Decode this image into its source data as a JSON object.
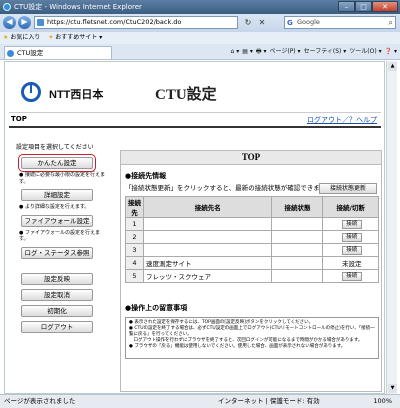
{
  "window": {
    "title": "CTU設定 - Windows Internet Explorer",
    "min": "–",
    "max": "□",
    "close": "✕"
  },
  "address": {
    "url": "https://ctu.fletsnet.com/CtuC202/back.do",
    "search_text": "Google",
    "back": "◀",
    "forward": "▶",
    "refresh": "↻",
    "stop": "✕"
  },
  "favorites": {
    "fav_label": "お気に入り",
    "suggest_label": "おすすめサイト ▾"
  },
  "tab": {
    "label": "CTU設定"
  },
  "commands": [
    "⌂ ▾",
    "▤ ▾",
    "🖶 ▾",
    "ページ(P) ▾",
    "セーフティ(S) ▾",
    "ツール(O) ▾",
    "❓ ▾"
  ],
  "header": {
    "brand": "NTT西日本",
    "title": "CTU設定"
  },
  "crumb": {
    "page": "TOP",
    "links": "ログアウト／？ヘルプ"
  },
  "side": {
    "hint": "設定項目を選択してください",
    "easy": "かんたん設定",
    "easy_note": "● 接続に必要な最小限の設定を行えます。",
    "detail": "詳細設定",
    "detail_note": "● より詳細な設定を行えます。",
    "firewall": "ファイアウォール設定",
    "firewall_note": "● ファイアウォールの設定を行えます。",
    "log": "ログ・ステータス参照",
    "apply": "設定反映",
    "cancel": "設定取消",
    "init": "初期化",
    "logout": "ログアウト"
  },
  "main": {
    "head": "TOP",
    "conn_title": "●接続先情報",
    "conn_sub": "「接続状態更新」をクリックすると、最新の接続状態が確認できます。",
    "refresh": "接続状態更新",
    "columns": [
      "接続先",
      "接続先名",
      "接続状態",
      "接続/切断"
    ],
    "rows": [
      {
        "n": "1",
        "name": "",
        "state": "",
        "action": "接続"
      },
      {
        "n": "2",
        "name": "",
        "state": "",
        "action": "接続"
      },
      {
        "n": "3",
        "name": "",
        "state": "",
        "action": "接続"
      },
      {
        "n": "4",
        "name": "速度測定サイト",
        "state": "",
        "action": "未設定"
      },
      {
        "n": "5",
        "name": "フレッツ・スクウェア",
        "state": "",
        "action": "接続"
      }
    ],
    "notes_title": "●操作上の留意事項",
    "notes": "● 表示された設定を保存するには、TOP画面の[設定反映]ボタンをクリックしてください。\n● CTUの設定を終了する場合は、必ずCTU設定の画面上でログアウト(CTUリモートコントロールの停止)を行い、「接続一覧に戻る」を行ってください。\n　ログアウト操作を行わずにブラウザを終了すると、次回ログインが可能になるまで時間がかかる場合があります。\n● ブラウザの「戻る」機能は使用しないでください。使用した場合、画面が表示されない場合があります。"
  },
  "status": {
    "left": "ページが表示されました",
    "middle": "インターネット | 保護モード: 有効",
    "zoom": "100%"
  }
}
